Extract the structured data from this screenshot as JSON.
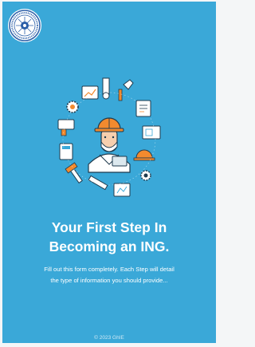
{
  "logo": {
    "icon": "institution-seal-icon",
    "seal_text": "GHANA INSTITUTION OF ENGINEERING"
  },
  "illustration": {
    "icon": "engineer-tools-illustration"
  },
  "hero": {
    "title_line1": "Your First Step In",
    "title_line2": "Becoming an ING.",
    "description_line1": "Fill out this form completely. Each Step will detail",
    "description_line2": "the type of information you should provide..."
  },
  "footer": {
    "copyright": "© 2023 GhIE"
  },
  "colors": {
    "panel_background": "#3aa8d8",
    "text": "#ffffff",
    "helmet": "#f28a2e"
  }
}
